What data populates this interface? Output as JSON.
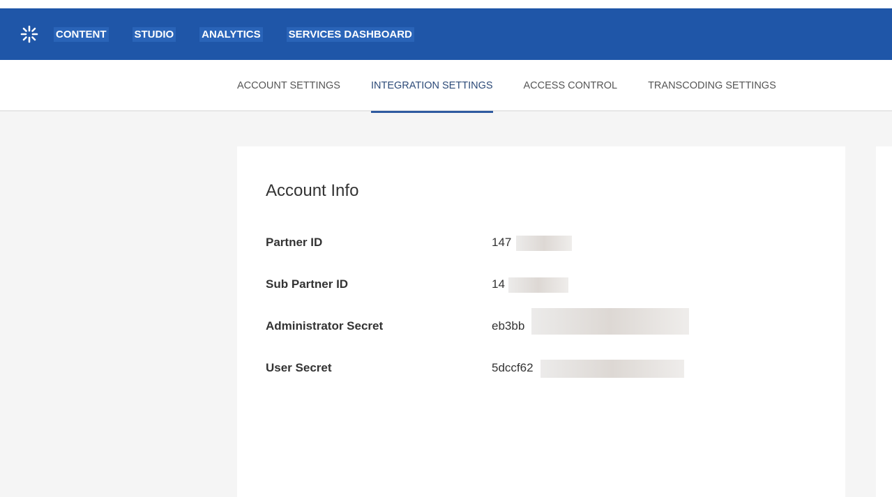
{
  "topbar": {
    "logo_icon": "kaltura-sunburst-icon",
    "nav": [
      {
        "label": "CONTENT"
      },
      {
        "label": "STUDIO"
      },
      {
        "label": "ANALYTICS"
      },
      {
        "label": "SERVICES DASHBOARD"
      }
    ],
    "color": "#1f56a8"
  },
  "subnav": {
    "tabs": [
      {
        "label": "ACCOUNT SETTINGS",
        "active": false
      },
      {
        "label": "INTEGRATION SETTINGS",
        "active": true
      },
      {
        "label": "ACCESS CONTROL",
        "active": false
      },
      {
        "label": "TRANSCODING SETTINGS",
        "active": false
      }
    ]
  },
  "account_info": {
    "title": "Account Info",
    "rows": [
      {
        "label": "Partner ID",
        "value": "147"
      },
      {
        "label": "Sub Partner ID",
        "value": "14         0"
      },
      {
        "label": "Administrator Secret",
        "value": "eb3bb                              a7c96967b0"
      },
      {
        "label": "User Secret",
        "value": "5dccf62                             45b0f7f3"
      }
    ]
  }
}
